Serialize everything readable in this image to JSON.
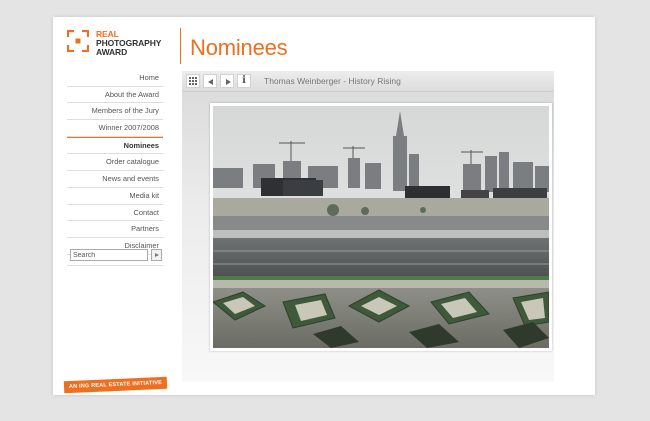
{
  "logo": {
    "line1": "REAL",
    "line2": "PHOTOGRAPHY",
    "line3": "AWARD",
    "accent": "#ee6f1f"
  },
  "page_title": "Nominees",
  "nav": {
    "items": [
      {
        "label": "Home",
        "active": false
      },
      {
        "label": "About the Award",
        "active": false
      },
      {
        "label": "Members of the Jury",
        "active": false
      },
      {
        "label": "Winner 2007/2008",
        "active": false
      },
      {
        "label": "Nominees",
        "active": true
      },
      {
        "label": "Order catalogue",
        "active": false
      },
      {
        "label": "News and events",
        "active": false
      },
      {
        "label": "Media kit",
        "active": false
      },
      {
        "label": "Contact",
        "active": false
      },
      {
        "label": "Partners",
        "active": false
      },
      {
        "label": "Disclaimer",
        "active": false
      }
    ]
  },
  "search": {
    "value": "Search"
  },
  "toolbar": {
    "icons": [
      "grid-icon",
      "prev-icon",
      "next-icon",
      "info-icon"
    ],
    "info_glyph": "i",
    "caption": "Thomas Weinberger - History Rising"
  },
  "badge": {
    "text": "AN ING REAL ESTATE INITIATIVE"
  }
}
